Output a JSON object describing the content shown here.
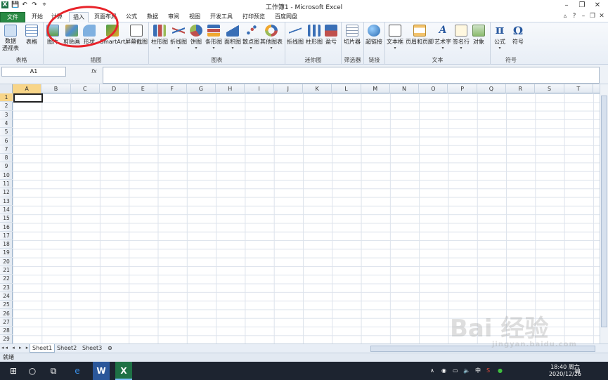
{
  "window": {
    "title": "工作簿1 - Microsoft Excel",
    "min": "–",
    "max": "❐",
    "close": "✕"
  },
  "qat": {
    "save": "💾",
    "undo": "↶",
    "redo": "↷",
    "extra": "⌖"
  },
  "tabs": [
    "文件",
    "开始",
    "计算",
    "插入",
    "页面布局",
    "公式",
    "数据",
    "审阅",
    "视图",
    "开发工具",
    "打印预览",
    "百度网盘"
  ],
  "ribbon": {
    "groups": {
      "tables": "表格",
      "illustrations": "插图",
      "charts": "图表",
      "sparklines": "迷你图",
      "filter": "筛选器",
      "links": "链接",
      "text": "文本",
      "symbols": "符号"
    },
    "buttons": {
      "pivot_table": "数据\n透视表",
      "table": "表格",
      "picture": "图片",
      "clip_art": "剪贴画",
      "shapes": "形状",
      "smartart": "SmartArt",
      "screenshot": "屏幕截图",
      "column_chart": "柱形图",
      "line_chart": "折线图",
      "pie_chart": "饼图",
      "bar_chart": "条形图",
      "area_chart": "面积图",
      "scatter_chart": "散点图",
      "other_charts": "其他图表",
      "spark_line": "折线图",
      "spark_column": "柱形图",
      "spark_winloss": "盈亏",
      "slicer": "切片器",
      "hyperlink": "超链接",
      "textbox": "文本框",
      "header_footer": "页眉和页脚",
      "wordart": "艺术字",
      "signature": "签名行",
      "object": "对象",
      "equation": "公式",
      "symbol": "符号"
    }
  },
  "formula": {
    "name_box": "A1",
    "fx": "fx",
    "value": ""
  },
  "columns": [
    "A",
    "B",
    "C",
    "D",
    "E",
    "F",
    "G",
    "H",
    "I",
    "J",
    "K",
    "L",
    "M",
    "N",
    "O",
    "P",
    "Q",
    "R",
    "S",
    "T"
  ],
  "rows": [
    "1",
    "2",
    "3",
    "4",
    "5",
    "6",
    "7",
    "8",
    "9",
    "10",
    "11",
    "12",
    "13",
    "14",
    "15",
    "16",
    "17",
    "18",
    "19",
    "20",
    "21",
    "22",
    "23",
    "24",
    "25",
    "26",
    "27",
    "28",
    "29"
  ],
  "sheets": [
    "Sheet1",
    "Sheet2",
    "Sheet3"
  ],
  "status": {
    "ready": "就绪"
  },
  "taskbar": {
    "time": "18:40 周六",
    "date": "2020/12/26",
    "ime": "中"
  },
  "watermark": {
    "main": "Bai 经验",
    "sub": "jingyan.baidu.com"
  },
  "colors": {
    "file_tab": "#2a8a44",
    "highlight": "#f8d588",
    "annotation": "#e8232a"
  }
}
